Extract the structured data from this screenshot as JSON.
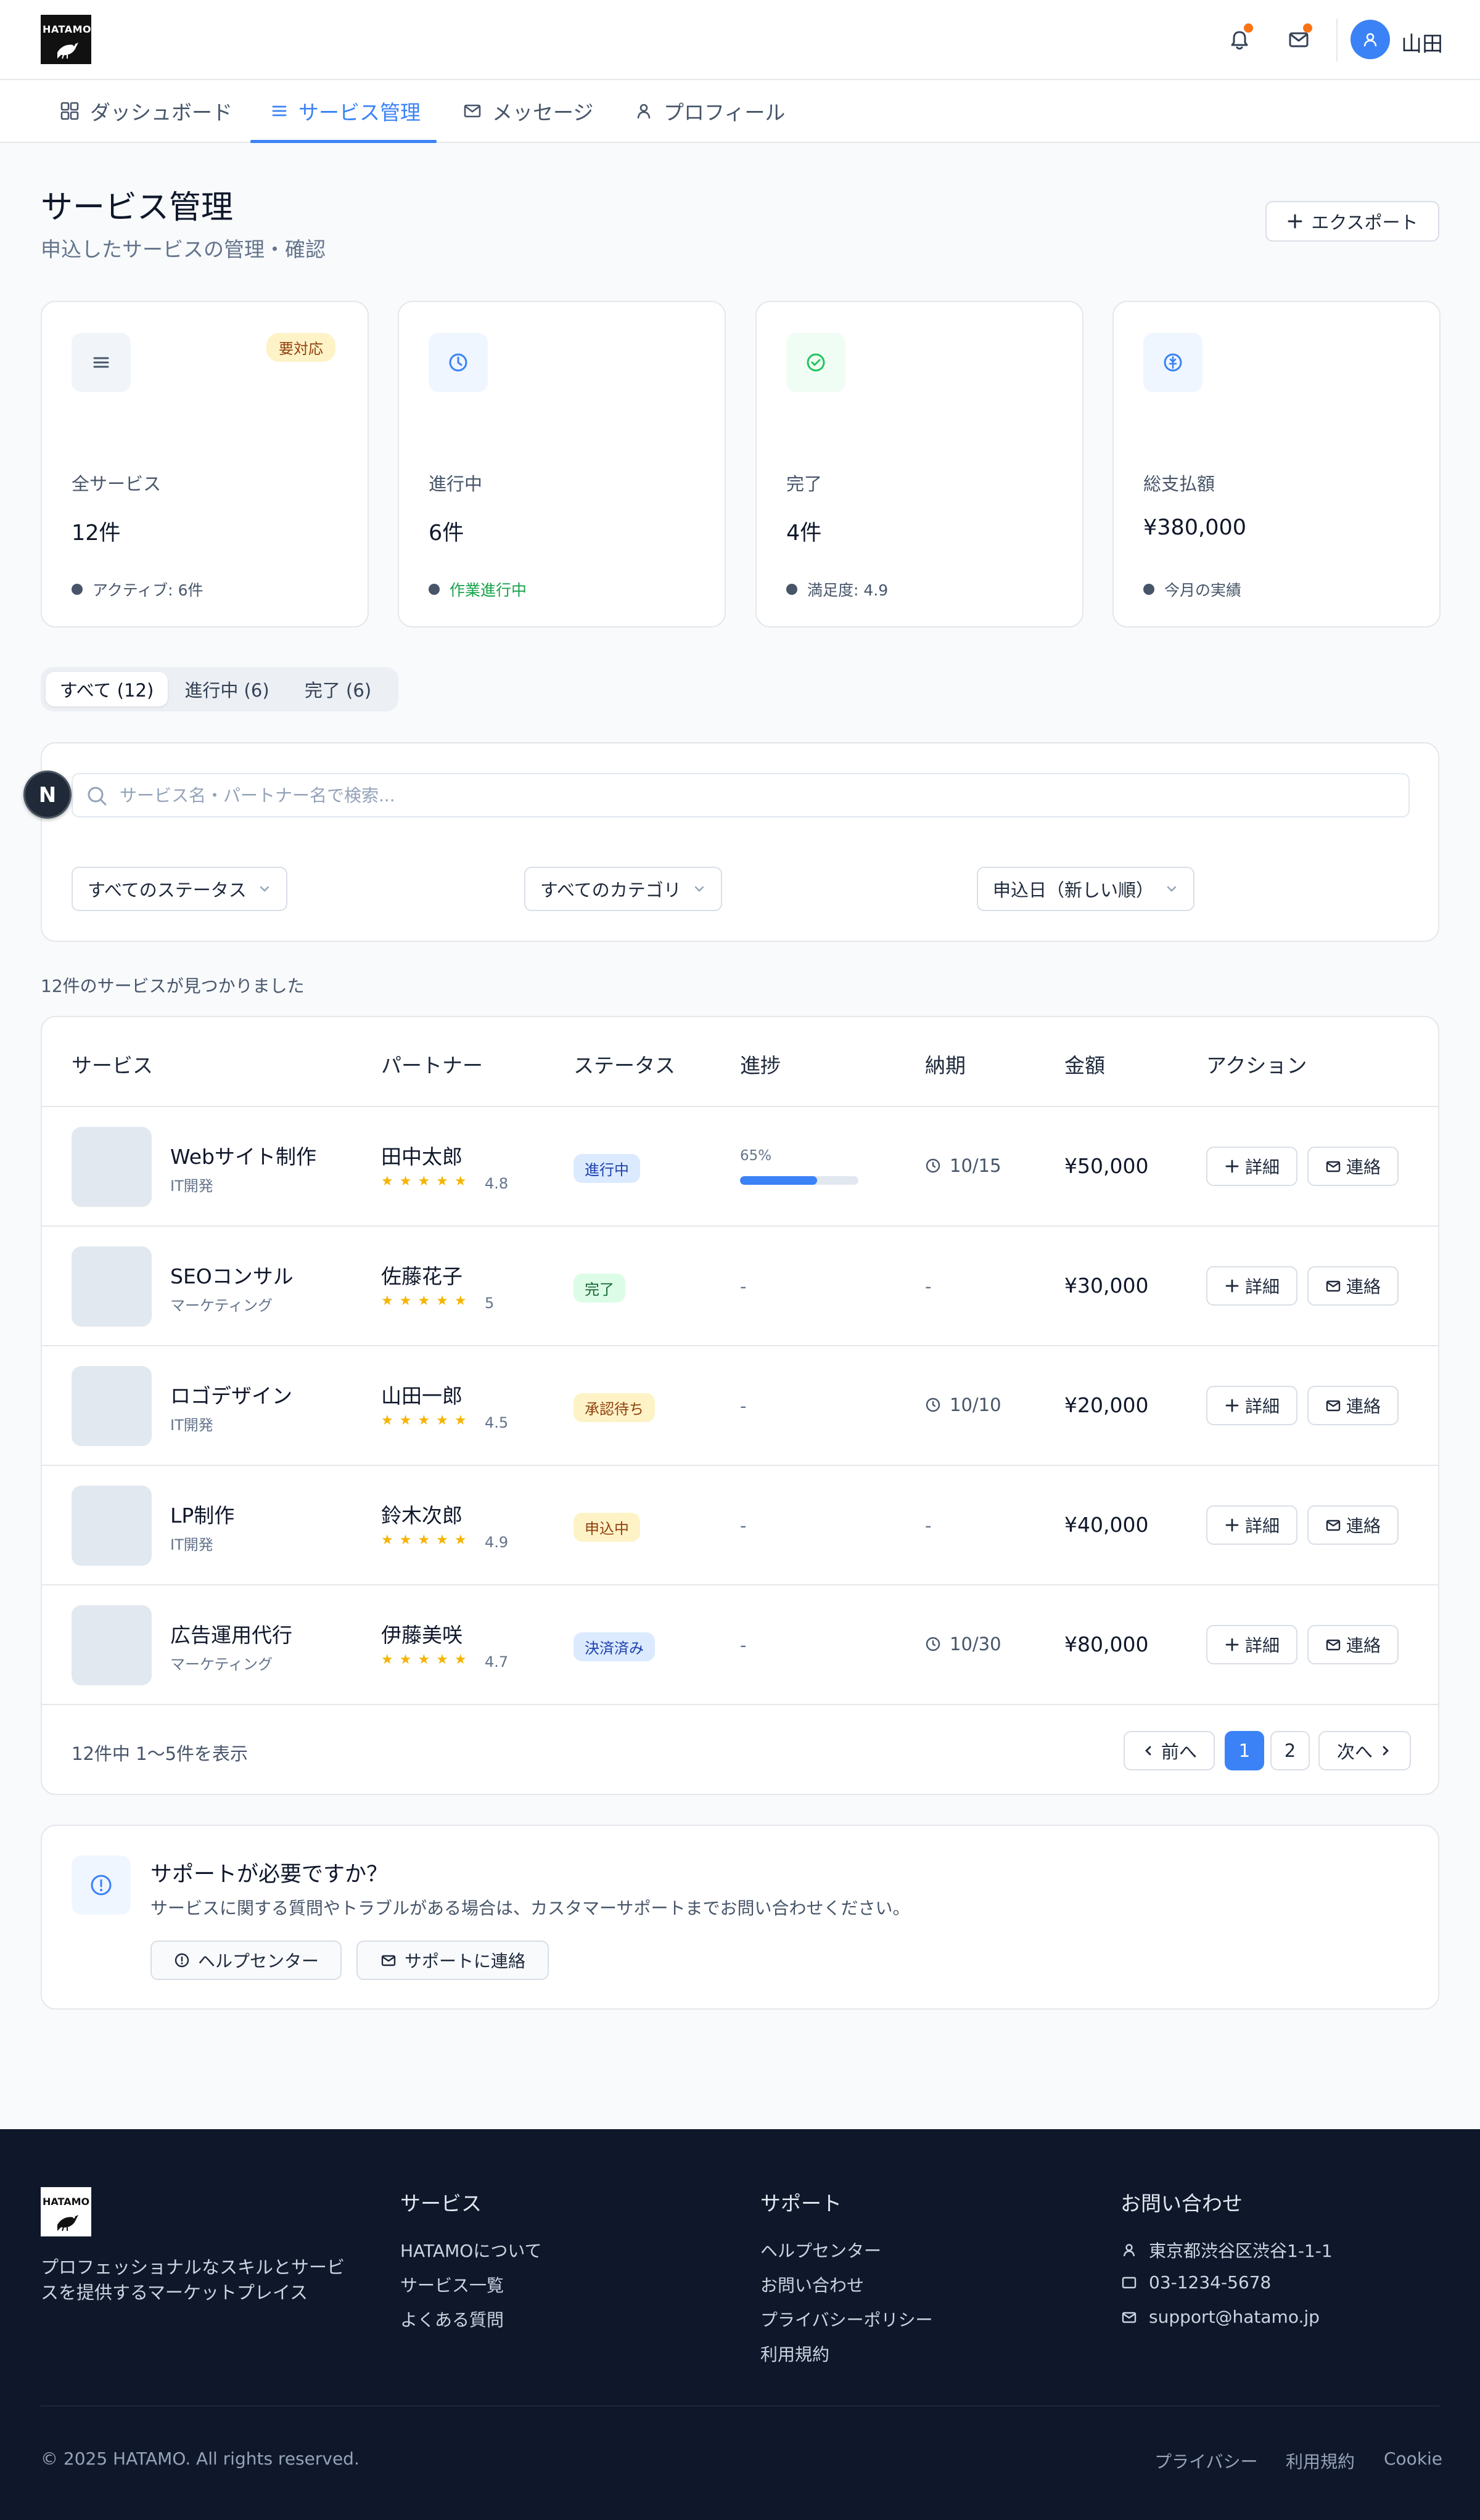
{
  "header": {
    "logo_text": "HATAMO",
    "user_name": "山田",
    "notification_badge": true,
    "mail_badge": true
  },
  "nav": {
    "tabs": [
      {
        "label": "ダッシュボード",
        "icon": "grid-icon",
        "active": false
      },
      {
        "label": "サービス管理",
        "icon": "list-icon",
        "active": true
      },
      {
        "label": "メッセージ",
        "icon": "mail-icon",
        "active": false
      },
      {
        "label": "プロフィール",
        "icon": "user-icon",
        "active": false
      }
    ]
  },
  "page": {
    "title": "サービス管理",
    "subtitle": "申込したサービスの管理・確認",
    "export_label": "エクスポート"
  },
  "stats": [
    {
      "label": "全サービス",
      "value": "12件",
      "badge": "要対応",
      "footer": "アクティブ: 6件",
      "icon": "list-icon",
      "icon_bg": "#f1f5f9",
      "icon_color": "#475569",
      "footer_color": "#475569"
    },
    {
      "label": "進行中",
      "value": "6件",
      "footer": "作業進行中",
      "icon": "clock-icon",
      "icon_bg": "#eff6ff",
      "icon_color": "#3b82f6",
      "footer_color": "#16a34a"
    },
    {
      "label": "完了",
      "value": "4件",
      "footer": "満足度: 4.9",
      "icon": "check-circle-icon",
      "icon_bg": "#f0fdf4",
      "icon_color": "#22c55e",
      "footer_color": "#475569"
    },
    {
      "label": "総支払額",
      "value": "¥380,000",
      "footer": "今月の実績",
      "icon": "yen-icon",
      "icon_bg": "#eff6ff",
      "icon_color": "#3b82f6",
      "footer_color": "#475569"
    }
  ],
  "filter_tabs": [
    {
      "label": "すべて (12)",
      "active": true
    },
    {
      "label": "進行中 (6)",
      "active": false
    },
    {
      "label": "完了 (6)",
      "active": false
    }
  ],
  "filters": {
    "search_placeholder": "サービス名・パートナー名で検索...",
    "search_value": "",
    "status_selected": "すべてのステータス",
    "category_selected": "すべてのカテゴリ",
    "sort_selected": "申込日（新しい順）"
  },
  "results_count": "12件のサービスが見つかりました",
  "table": {
    "headers": [
      "サービス",
      "パートナー",
      "ステータス",
      "進捗",
      "納期",
      "金額",
      "アクション"
    ],
    "detail_label": "詳細",
    "contact_label": "連絡",
    "star_glyphs": "★★★★★",
    "rows": [
      {
        "service": "Webサイト制作",
        "category": "IT開発",
        "partner": "田中太郎",
        "rating": "4.8",
        "status": "進行中",
        "status_bg": "#dbeafe",
        "status_color": "#1e40af",
        "progress_label": "65%",
        "progress": 0.65,
        "due": "10/15",
        "amount": "¥50,000"
      },
      {
        "service": "SEOコンサル",
        "category": "マーケティング",
        "partner": "佐藤花子",
        "rating": "5",
        "status": "完了",
        "status_bg": "#dcfce7",
        "status_color": "#166534",
        "progress_label": "-",
        "progress": null,
        "due": "-",
        "amount": "¥30,000"
      },
      {
        "service": "ロゴデザイン",
        "category": "IT開発",
        "partner": "山田一郎",
        "rating": "4.5",
        "status": "承認待ち",
        "status_bg": "#fef3c7",
        "status_color": "#92400e",
        "progress_label": "-",
        "progress": null,
        "due": "10/10",
        "amount": "¥20,000"
      },
      {
        "service": "LP制作",
        "category": "IT開発",
        "partner": "鈴木次郎",
        "rating": "4.9",
        "status": "申込中",
        "status_bg": "#fef3c7",
        "status_color": "#92400e",
        "progress_label": "-",
        "progress": null,
        "due": "-",
        "amount": "¥40,000"
      },
      {
        "service": "広告運用代行",
        "category": "マーケティング",
        "partner": "伊藤美咲",
        "rating": "4.7",
        "status": "決済済み",
        "status_bg": "#dbeafe",
        "status_color": "#1e40af",
        "progress_label": "-",
        "progress": null,
        "due": "10/30",
        "amount": "¥80,000"
      }
    ]
  },
  "pagination": {
    "info": "12件中 1〜5件を表示",
    "prev_label": "前へ",
    "next_label": "次へ",
    "pages": [
      "1",
      "2"
    ],
    "current": "1"
  },
  "support": {
    "title": "サポートが必要ですか？",
    "description": "サービスに関する質問やトラブルがある場合は、カスタマーサポートまでお問い合わせください。",
    "help_label": "ヘルプセンター",
    "contact_label": "サポートに連絡"
  },
  "footer": {
    "logo_text": "HATAMO",
    "tagline": "プロフェッショナルなスキルとサービスを提供するマーケットプレイス",
    "col_service": {
      "title": "サービス",
      "links": [
        "HATAMOについて",
        "サービス一覧",
        "よくある質問"
      ]
    },
    "col_support": {
      "title": "サポート",
      "links": [
        "ヘルプセンター",
        "お問い合わせ",
        "プライバシーポリシー",
        "利用規約"
      ]
    },
    "col_contact": {
      "title": "お問い合わせ",
      "address": "東京都渋谷区渋谷1-1-1",
      "phone": "03-1234-5678",
      "email": "support@hatamo.jp"
    },
    "copyright": "© 2025 HATAMO. All rights reserved.",
    "bottom_links": [
      "プライバシー",
      "利用規約",
      "Cookie"
    ]
  },
  "nextjs_badge_letter": "N"
}
